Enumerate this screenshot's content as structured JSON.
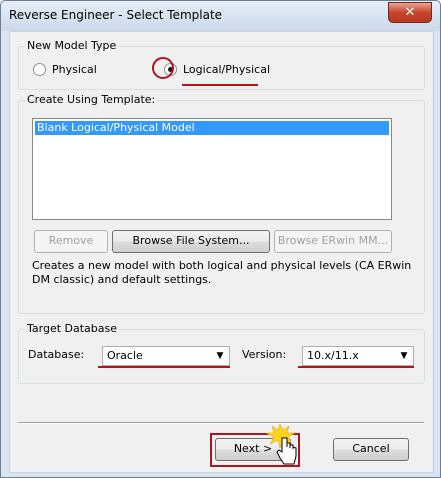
{
  "window": {
    "title": "Reverse Engineer - Select Template",
    "close_glyph": "✕"
  },
  "model_type": {
    "group_label": "New Model Type",
    "options": [
      {
        "label": "Physical",
        "selected": false
      },
      {
        "label": "Logical/Physical",
        "selected": true
      }
    ]
  },
  "template": {
    "group_label": "Create Using Template:",
    "items": [
      "Blank Logical/Physical Model"
    ],
    "selected_index": 0,
    "buttons": {
      "remove": "Remove",
      "browse_file": "Browse File System...",
      "browse_erwin": "Browse ERwin MM..."
    },
    "description": "Creates a new model with both logical and physical levels (CA ERwin DM classic) and default settings."
  },
  "target_db": {
    "group_label": "Target Database",
    "database_label": "Database:",
    "database_value": "Oracle",
    "version_label": "Version:",
    "version_value": "10.x/11.x"
  },
  "footer": {
    "next": "Next >",
    "cancel": "Cancel"
  },
  "annotation_color": "#b5121b"
}
